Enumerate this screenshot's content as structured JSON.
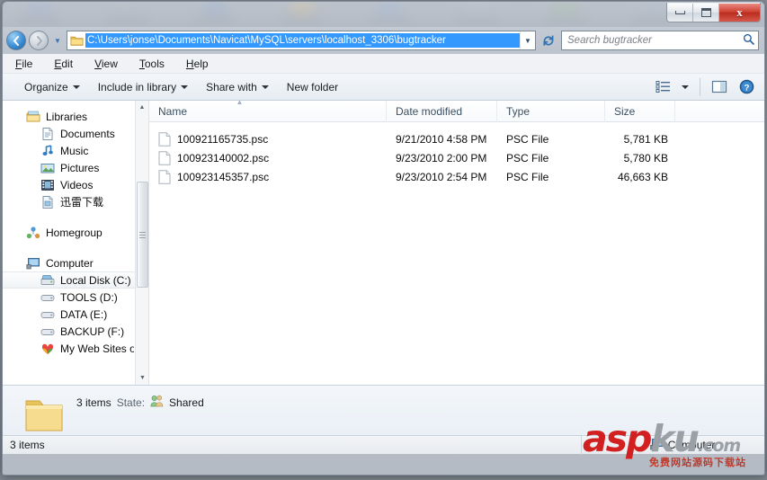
{
  "window": {
    "controls": {
      "minimize_label": "Minimize",
      "maximize_label": "Maximize",
      "close_label": "x"
    }
  },
  "address_bar": {
    "back_label": "←",
    "forward_label": "→",
    "recent_locations_label": "▼",
    "path": "C:\\Users\\jonse\\Documents\\Navicat\\MySQL\\servers\\localhost_3306\\bugtracker",
    "dropdown_label": "▼",
    "refresh_label": "↻",
    "search_placeholder": "Search bugtracker",
    "search_icon_label": "⌕"
  },
  "menu_bar": {
    "items": [
      {
        "accel": "F",
        "rest": "ile"
      },
      {
        "accel": "E",
        "rest": "dit"
      },
      {
        "accel": "V",
        "rest": "iew"
      },
      {
        "accel": "T",
        "rest": "ools"
      },
      {
        "accel": "H",
        "rest": "elp"
      }
    ]
  },
  "toolbar": {
    "organize_label": "Organize",
    "include_in_library_label": "Include in library",
    "share_with_label": "Share with",
    "new_folder_label": "New folder",
    "view_mode_label": "Change your view",
    "view_dropdown_label": "▼",
    "preview_pane_label": "Show the preview pane",
    "help_label": "?"
  },
  "navigation_pane": {
    "groups": [
      {
        "name": "libraries",
        "rows": [
          {
            "label": "Libraries",
            "icon": "libraries-icon",
            "level": 0
          },
          {
            "label": "Documents",
            "icon": "documents-icon",
            "level": 1
          },
          {
            "label": "Music",
            "icon": "music-icon",
            "level": 1
          },
          {
            "label": "Pictures",
            "icon": "pictures-icon",
            "level": 1
          },
          {
            "label": "Videos",
            "icon": "videos-icon",
            "level": 1
          },
          {
            "label": "迅雷下载",
            "icon": "downloads-icon",
            "level": 1
          }
        ]
      },
      {
        "name": "homegroup",
        "rows": [
          {
            "label": "Homegroup",
            "icon": "homegroup-icon",
            "level": 0
          }
        ]
      },
      {
        "name": "computer",
        "rows": [
          {
            "label": "Computer",
            "icon": "computer-icon",
            "level": 0
          },
          {
            "label": "Local Disk (C:)",
            "icon": "local-disk-icon",
            "level": 1,
            "selected": true
          },
          {
            "label": "TOOLS (D:)",
            "icon": "drive-icon",
            "level": 1
          },
          {
            "label": "DATA (E:)",
            "icon": "drive-icon",
            "level": 1
          },
          {
            "label": "BACKUP (F:)",
            "icon": "drive-icon",
            "level": 1
          },
          {
            "label": "My Web Sites on",
            "icon": "web-sites-icon",
            "level": 1,
            "truncated": true
          }
        ]
      }
    ],
    "scrollbar": {
      "up_label": "▲",
      "down_label": "▼"
    }
  },
  "file_list": {
    "columns": {
      "name": "Name",
      "date_modified": "Date modified",
      "type": "Type",
      "size": "Size"
    },
    "sort_indicator": "▲",
    "rows": [
      {
        "name": "100921165735.psc",
        "date_modified": "9/21/2010 4:58 PM",
        "type": "PSC File",
        "size": "5,781 KB"
      },
      {
        "name": "100923140002.psc",
        "date_modified": "9/23/2010 2:00 PM",
        "type": "PSC File",
        "size": "5,780 KB"
      },
      {
        "name": "100923145357.psc",
        "date_modified": "9/23/2010 2:54 PM",
        "type": "PSC File",
        "size": "46,663 KB"
      }
    ]
  },
  "details_pane": {
    "item_count": "3 items",
    "state_label": "State:",
    "state_value": "Shared"
  },
  "status_bar": {
    "item_count": "3 items",
    "location": "Computer"
  },
  "watermark": {
    "part_asp": "asp",
    "part_ku": "ku",
    "part_com": ".com",
    "subtitle": "免费网站源码下载站"
  },
  "colors": {
    "selection_blue": "#3399ff",
    "close_red": "#c0392b",
    "accent_blue": "#2f73b4",
    "watermark_red": "#d1201f"
  }
}
